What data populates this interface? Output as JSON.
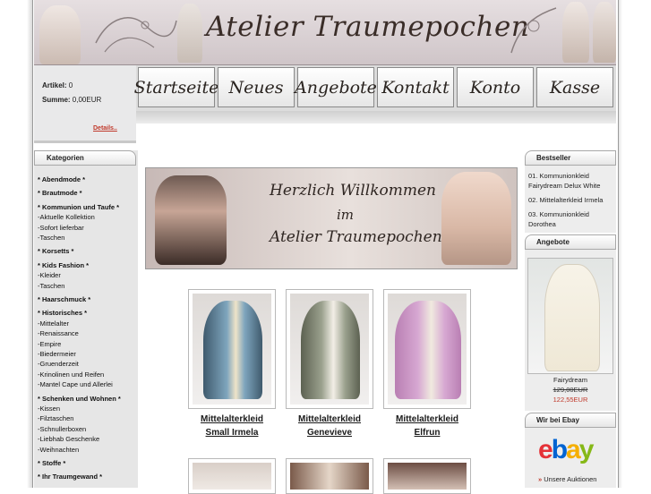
{
  "header": {
    "title": "Atelier Traumepochen"
  },
  "cart": {
    "articles_label": "Artikel:",
    "articles_value": "0",
    "sum_label": "Summe:",
    "sum_value": "0,00EUR",
    "details_label": "Details.."
  },
  "nav": {
    "items": [
      {
        "label": "Startseite"
      },
      {
        "label": "Neues"
      },
      {
        "label": "Angebote"
      },
      {
        "label": "Kontakt"
      },
      {
        "label": "Konto"
      },
      {
        "label": "Kasse"
      }
    ]
  },
  "sidebar": {
    "title": "Kategorien",
    "items": [
      {
        "label": "* Abendmode *",
        "bold": true
      },
      {
        "label": "* Brautmode *",
        "bold": true
      },
      {
        "label": "* Kommunion und Taufe *",
        "bold": true
      },
      {
        "label": "-Aktuelle Kollektion",
        "bold": false
      },
      {
        "label": "-Sofort lieferbar",
        "bold": false
      },
      {
        "label": "-Taschen",
        "bold": false
      },
      {
        "label": "* Korsetts *",
        "bold": true
      },
      {
        "label": "* Kids Fashion *",
        "bold": true
      },
      {
        "label": "-Kleider",
        "bold": false
      },
      {
        "label": "-Taschen",
        "bold": false
      },
      {
        "label": "* Haarschmuck *",
        "bold": true
      },
      {
        "label": "* Historisches *",
        "bold": true
      },
      {
        "label": "-Mittelalter",
        "bold": false
      },
      {
        "label": "-Renaissance",
        "bold": false
      },
      {
        "label": "-Empire",
        "bold": false
      },
      {
        "label": "-Biedermeier",
        "bold": false
      },
      {
        "label": "-Gruenderzeit",
        "bold": false
      },
      {
        "label": "-Krinolinen und Reifen",
        "bold": false
      },
      {
        "label": "-Mantel Cape und Allerlei",
        "bold": false
      },
      {
        "label": "* Schenken und Wohnen *",
        "bold": true
      },
      {
        "label": "-Kissen",
        "bold": false
      },
      {
        "label": "-Filztaschen",
        "bold": false
      },
      {
        "label": "-Schnullerboxen",
        "bold": false
      },
      {
        "label": "-Liebhab Geschenke",
        "bold": false
      },
      {
        "label": "-Weihnachten",
        "bold": false
      },
      {
        "label": "* Stoffe *",
        "bold": true
      },
      {
        "label": "* Ihr Traumgewand *",
        "bold": true
      }
    ]
  },
  "welcome": {
    "line1": "Herzlich Willkommen",
    "line2": "im",
    "line3": "Atelier Traumepochen"
  },
  "products": [
    {
      "name_line1": "Mittelalterkleid",
      "name_line2": "Small Irmela",
      "color": "#7a9fb5"
    },
    {
      "name_line1": "Mittelalterkleid",
      "name_line2": "Genevieve",
      "color": "#8c9180"
    },
    {
      "name_line1": "Mittelalterkleid",
      "name_line2": "Elfrun",
      "color": "#c99ac4"
    }
  ],
  "bestseller": {
    "title": "Bestseller",
    "items": [
      "01. Kommunionkleid Fairydream Delux White",
      "02. Mittelalterkleid Irmela",
      "03. Kommunionkleid Dorothea"
    ]
  },
  "offers": {
    "title": "Angebote",
    "name": "Fairydream",
    "old_price": "129,00EUR",
    "new_price": "122,55EUR"
  },
  "ebay": {
    "title": "Wir bei Ebay",
    "logo_text": "ebay",
    "link_label": "Unsere Auktionen"
  }
}
